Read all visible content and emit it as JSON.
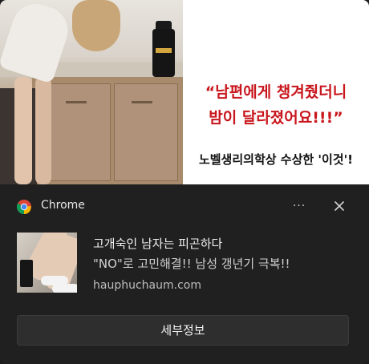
{
  "hero": {
    "quote_line1": "“남편에게 챙겨줬더니",
    "quote_line2": "밤이 달라졌어요!!!”",
    "tagline": "노벨생리의학상 수상한 '이것'!",
    "accent_color": "#c8161d"
  },
  "header": {
    "app_name": "Chrome",
    "app_icon": "chrome-icon",
    "more_label": "···",
    "close_icon": "close-icon"
  },
  "notification": {
    "title": "고개숙인 남자는 피곤하다",
    "body": "\"NO\"로 고민해결!! 남성 갱년기 극복!!",
    "source": "hauphuchaum.com"
  },
  "action": {
    "button_label": "세부정보"
  }
}
